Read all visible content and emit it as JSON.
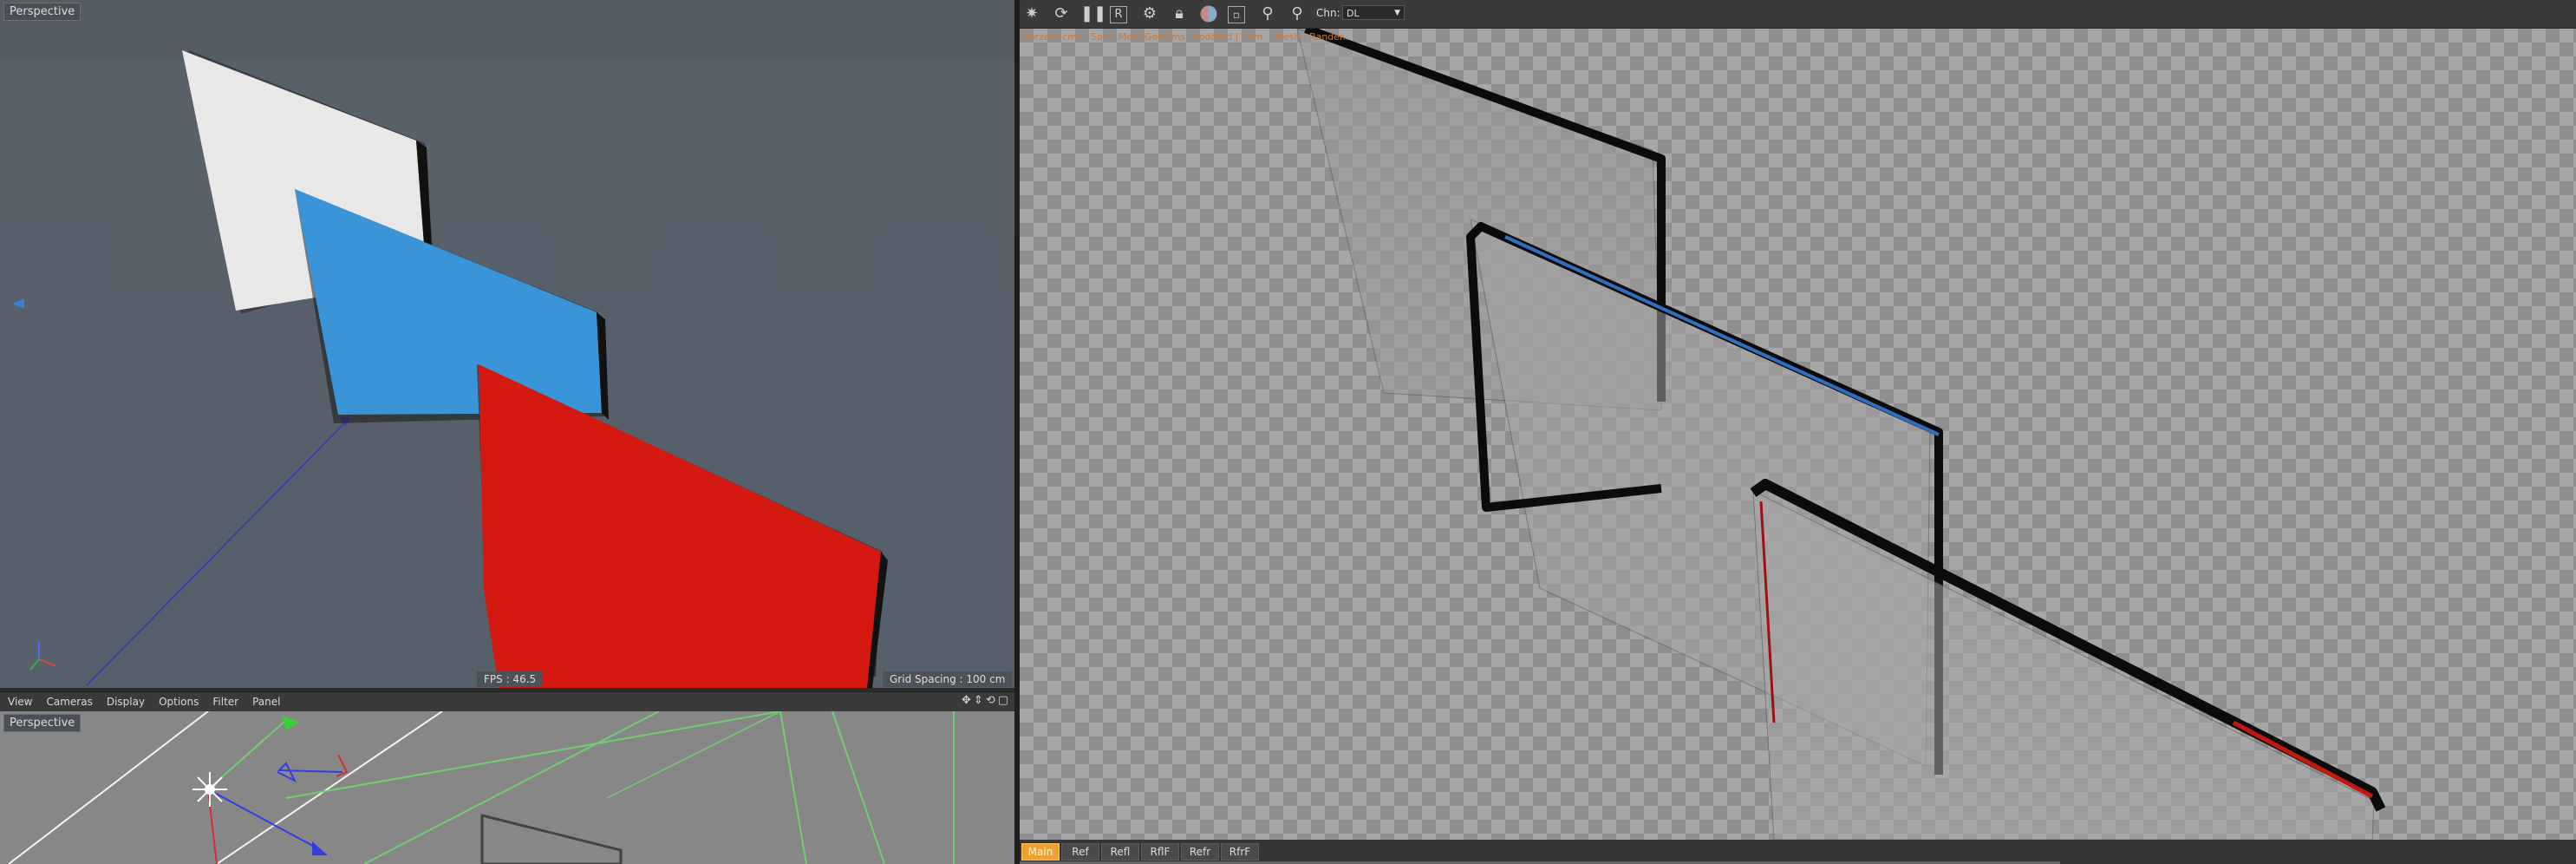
{
  "viewport_top": {
    "label": "Perspective",
    "fps": "FPS : 46.5",
    "grid_spacing": "Grid Spacing : 100 cm"
  },
  "viewport_menu": {
    "items": [
      "View",
      "Cameras",
      "Display",
      "Options",
      "Filter",
      "Panel"
    ],
    "nav_icons": "✥⇕⟲▢"
  },
  "viewport_bottom": {
    "label": "Perspective"
  },
  "render_toolbar": {
    "icons": [
      "render-gear-icon",
      "refresh-icon",
      "pause-icon",
      "region-render-icon",
      "settings-gear-icon",
      "lock-icon",
      "color-sphere-icon",
      "frame-icon",
      "pin-icon",
      "pin-alt-icon"
    ],
    "channel_label": "Chn:",
    "channel_value": "DL"
  },
  "render_view": {
    "stats": "Obrzekr  cms : Sam. MesHGenDms: Updated | Sam. | Mesh : Rander..."
  },
  "passes": [
    "Main",
    "Ref",
    "Refl",
    "RflF",
    "Refr",
    "RfrF"
  ],
  "active_pass": "Main",
  "colors": {
    "plane_white": "#e6e6e6",
    "plane_blue": "#3a95d8",
    "plane_red": "#d41a10",
    "active_tab": "#f0a030"
  }
}
